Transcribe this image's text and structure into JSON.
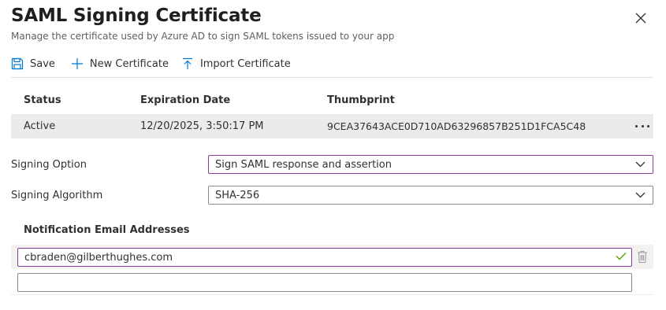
{
  "header": {
    "title": "SAML Signing Certificate",
    "subtitle": "Manage the certificate used by Azure AD to sign SAML tokens issued to your app"
  },
  "toolbar": {
    "save_label": "Save",
    "new_certificate_label": "New Certificate",
    "import_certificate_label": "Import Certificate"
  },
  "table": {
    "columns": [
      "Status",
      "Expiration Date",
      "Thumbprint"
    ],
    "rows": [
      {
        "status": "Active",
        "expiration": "12/20/2025, 3:50:17 PM",
        "thumbprint": "9CEA37643ACE0D710AD63296857B251D1FCA5C48"
      }
    ]
  },
  "signing_option": {
    "label": "Signing Option",
    "value": "Sign SAML response and assertion"
  },
  "signing_algorithm": {
    "label": "Signing Algorithm",
    "value": "SHA-256"
  },
  "notifications": {
    "title": "Notification Email Addresses",
    "emails": [
      "cbraden@gilberthughes.com"
    ],
    "new_email_value": ""
  },
  "colors": {
    "accent_purple": "#8a3ea0",
    "save_icon_blue": "#0078d4",
    "valid_green": "#57a300",
    "row_bg": "#edebe9"
  },
  "icons": {
    "close": "close-icon",
    "save": "save-icon",
    "new": "plus-icon",
    "import": "upload-icon",
    "more": "more-icon",
    "dropdown": "chevron-down-icon",
    "valid": "checkmark-icon",
    "delete": "trash-icon"
  }
}
